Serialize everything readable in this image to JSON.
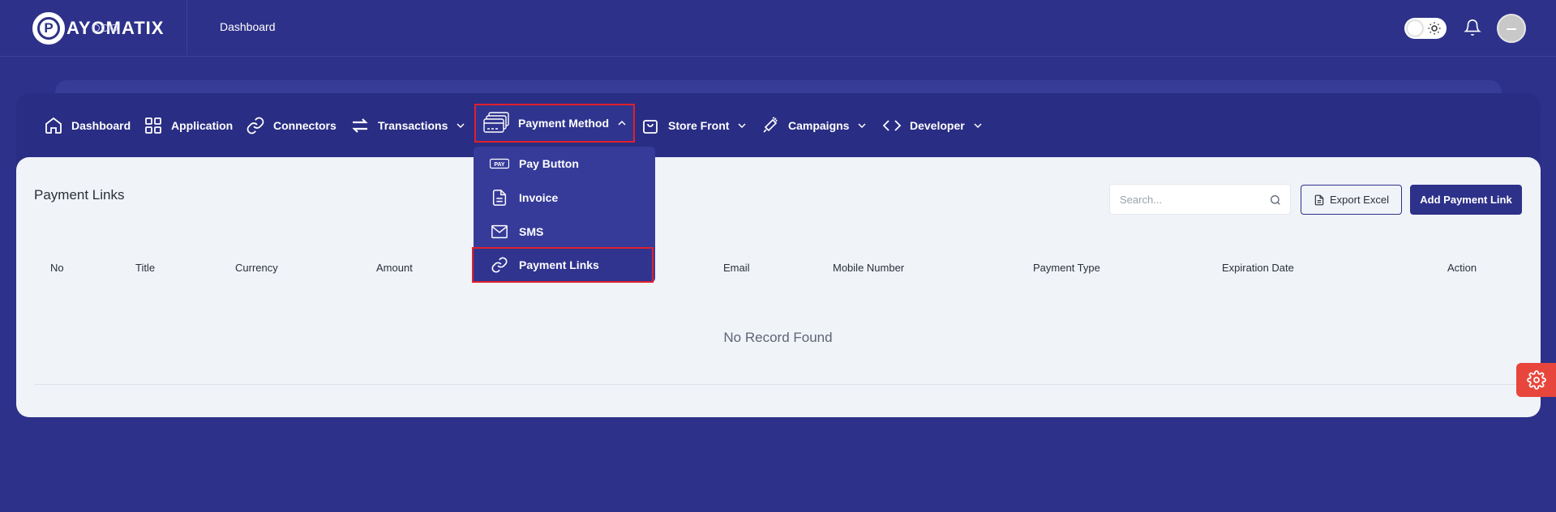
{
  "header": {
    "logo_letter": "P",
    "logo_text": "AYOMATIX",
    "title": "Dashboard"
  },
  "nav": {
    "items": [
      {
        "label": "Dashboard",
        "icon": "home-icon"
      },
      {
        "label": "Application",
        "icon": "grid-icon"
      },
      {
        "label": "Connectors",
        "icon": "link-icon"
      },
      {
        "label": "Transactions",
        "icon": "swap-arrows-icon"
      },
      {
        "label": "Payment Method",
        "icon": "cards-icon",
        "active": true
      },
      {
        "label": "Store Front",
        "icon": "shopping-bag-icon"
      },
      {
        "label": "Campaigns",
        "icon": "megaphone-icon"
      },
      {
        "label": "Developer",
        "icon": "code-icon"
      }
    ]
  },
  "dropdown": {
    "items": [
      {
        "label": "Pay Button",
        "icon": "pay-icon",
        "badge": "PAY"
      },
      {
        "label": "Invoice",
        "icon": "document-icon"
      },
      {
        "label": "SMS",
        "icon": "mail-icon"
      },
      {
        "label": "Payment Links",
        "icon": "link-icon",
        "active": true
      }
    ]
  },
  "page": {
    "title": "Payment Links",
    "search_placeholder": "Search...",
    "export_label": "Export Excel",
    "add_label": "Add Payment Link"
  },
  "table": {
    "columns": [
      "No",
      "Title",
      "Currency",
      "Amount",
      "Email",
      "Mobile Number",
      "Payment Type",
      "Expiration Date",
      "Action"
    ],
    "empty_text": "No Record Found"
  },
  "colors": {
    "background": "#2d3189",
    "panel": "#f0f3f8",
    "highlight": "#e1202b",
    "fab": "#e8463c"
  }
}
